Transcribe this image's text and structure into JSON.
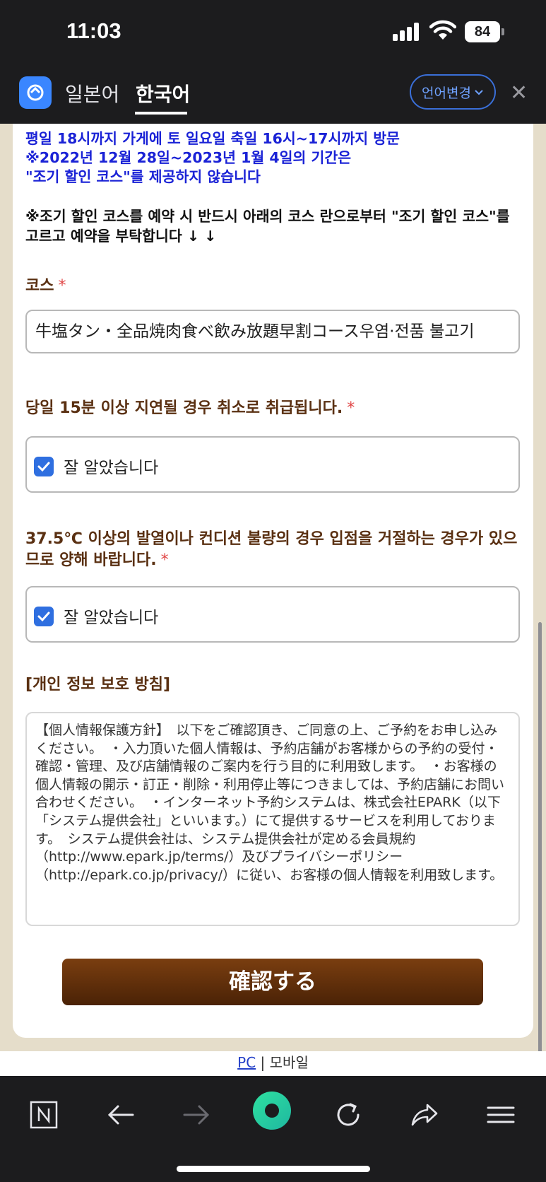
{
  "status_bar": {
    "time": "11:03",
    "battery": "84"
  },
  "translate_bar": {
    "source_lang": "일본어",
    "target_lang": "한국어",
    "change_label": "언어변경"
  },
  "notices": {
    "blue_line1": "평일 18시까지 가게에 토 일요일 축일 16시~17시까지 방문",
    "blue_line2": "※2022년 12월 28일~2023년 1월 4일의 기간은",
    "blue_line3": "\"조기 할인 코스\"를 제공하지 않습니다",
    "black_text": "※조기 할인 코스를 예약 시 반드시 아래의 코스 란으로부터 \"조기 할인 코스\"를 고르고 예약을 부탁합니다 ↓ ↓"
  },
  "course": {
    "label": "코스",
    "required_mark": "*",
    "selected_value": "牛塩タン・全品焼肉食べ飲み放題早割コース우염·전품 불고기"
  },
  "late_policy": {
    "label": "당일 15분 이상 지연될 경우 취소로 취급됩니다.",
    "required_mark": "*",
    "checkbox_label": "잘 알았습니다",
    "checked": true
  },
  "fever_policy": {
    "label": "37.5℃ 이상의 발열이나 컨디션 불량의 경우 입점을 거절하는 경우가 있으므로 양해 바랍니다.",
    "required_mark": "*",
    "checkbox_label": "잘 알았습니다",
    "checked": true
  },
  "privacy": {
    "heading": "[개인 정보 보호 방침]",
    "text": "【個人情報保護方針】　以下をご確認頂き、ご同意の上、ご予約をお申し込みください。　・入力頂いた個人情報は、予約店舗がお客様からの予約の受付・確認・管理、及び店舗情報のご案内を行う目的に利用致します。　・お客様の個人情報の開示・訂正・削除・利用停止等につきましては、予約店舗にお問い合わせください。　・インターネット予約システムは、株式会社EPARK（以下「システム提供会社」といいます。）にて提供するサービスを利用しております。　システム提供会社は、システム提供会社が定める会員規約（http://www.epark.jp/terms/）及びプライバシーポリシー（http://epark.co.jp/privacy/）に従い、お客様の個人情報を利用致します。"
  },
  "confirm_button": "確認する",
  "footer": {
    "pc_link": "PC",
    "separator": "|",
    "mobile": "모바일"
  },
  "toolbar": {
    "items": [
      "n-tab-icon",
      "back-arrow-icon",
      "forward-arrow-icon",
      "home-green-icon",
      "reload-icon",
      "share-icon",
      "menu-icon"
    ]
  },
  "colors": {
    "accent_blue": "#1a22d6",
    "label_brown": "#5a3012",
    "button_brown": "#5a2a0a",
    "checkbox_blue": "#2f6fe0",
    "page_beige": "#e5ddca"
  }
}
